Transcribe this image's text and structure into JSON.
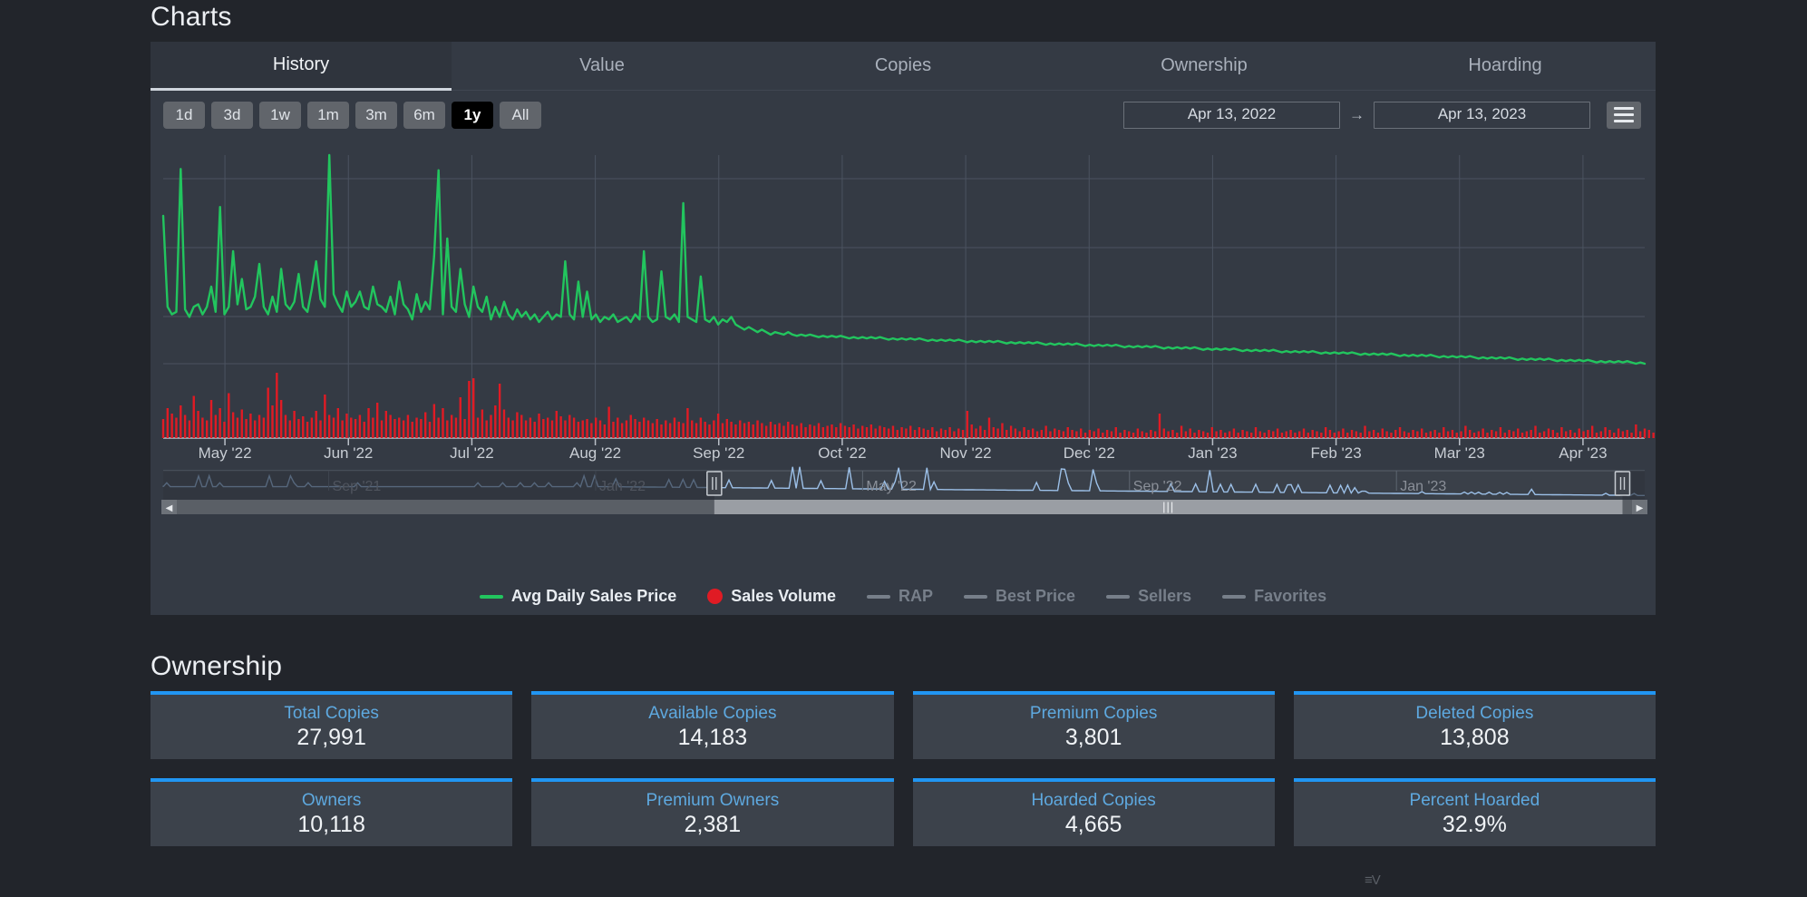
{
  "charts": {
    "title": "Charts",
    "tabs": [
      {
        "label": "History",
        "active": true
      },
      {
        "label": "Value",
        "active": false
      },
      {
        "label": "Copies",
        "active": false
      },
      {
        "label": "Ownership",
        "active": false
      },
      {
        "label": "Hoarding",
        "active": false
      }
    ],
    "range_buttons": [
      {
        "label": "1d",
        "active": false
      },
      {
        "label": "3d",
        "active": false
      },
      {
        "label": "1w",
        "active": false
      },
      {
        "label": "1m",
        "active": false
      },
      {
        "label": "3m",
        "active": false
      },
      {
        "label": "6m",
        "active": false
      },
      {
        "label": "1y",
        "active": true
      },
      {
        "label": "All",
        "active": false
      }
    ],
    "date_from": "Apr 13, 2022",
    "date_arrow": "→",
    "date_to": "Apr 13, 2023",
    "menu_icon": "hamburger-menu-icon",
    "legend": [
      {
        "label": "Avg Daily Sales Price",
        "marker": "line",
        "color": "#22c55e",
        "enabled": true
      },
      {
        "label": "Sales Volume",
        "marker": "dot",
        "color": "#e01b24",
        "enabled": true
      },
      {
        "label": "RAP",
        "marker": "line",
        "color": "#777f8a",
        "enabled": false
      },
      {
        "label": "Best Price",
        "marker": "line",
        "color": "#777f8a",
        "enabled": false
      },
      {
        "label": "Sellers",
        "marker": "line",
        "color": "#777f8a",
        "enabled": false
      },
      {
        "label": "Favorites",
        "marker": "line",
        "color": "#777f8a",
        "enabled": false
      }
    ]
  },
  "ownership": {
    "title": "Ownership",
    "cards": [
      {
        "label": "Total Copies",
        "value": "27,991"
      },
      {
        "label": "Available Copies",
        "value": "14,183"
      },
      {
        "label": "Premium Copies",
        "value": "3,801"
      },
      {
        "label": "Deleted Copies",
        "value": "13,808"
      },
      {
        "label": "Owners",
        "value": "10,118"
      },
      {
        "label": "Premium Owners",
        "value": "2,381"
      },
      {
        "label": "Hoarded Copies",
        "value": "4,665"
      },
      {
        "label": "Percent Hoarded",
        "value": "32.9%"
      }
    ]
  },
  "watermark": "≡V",
  "chart_data": {
    "type": "line",
    "title": "History",
    "xlabel": "",
    "ylabel": "",
    "grid": true,
    "legend_position": "bottom",
    "x_ticks": [
      "May '22",
      "Jun '22",
      "Jul '22",
      "Aug '22",
      "Sep '22",
      "Oct '22",
      "Nov '22",
      "Dec '22",
      "Jan '23",
      "Feb '23",
      "Mar '23",
      "Apr '23"
    ],
    "navigator": {
      "x_ticks": [
        "Sep '21",
        "Jan '22",
        "May '22",
        "Sep '22",
        "Jan '23"
      ],
      "selection_start_fraction": 0.372,
      "selection_end_fraction": 0.985,
      "color": "#9cc0e8"
    },
    "series": [
      {
        "name": "Avg Daily Sales Price",
        "type": "line",
        "color": "#22c55e",
        "values": [
          168,
          96,
          90,
          92,
          205,
          94,
          88,
          96,
          98,
          90,
          96,
          112,
          92,
          175,
          90,
          96,
          140,
          98,
          118,
          94,
          96,
          104,
          130,
          96,
          90,
          104,
          92,
          126,
          98,
          94,
          100,
          122,
          96,
          92,
          110,
          132,
          102,
          96,
          216,
          106,
          98,
          92,
          108,
          96,
          100,
          108,
          96,
          94,
          112,
          98,
          96,
          92,
          104,
          90,
          116,
          98,
          94,
          86,
          106,
          92,
          100,
          94,
          136,
          204,
          90,
          150,
          96,
          92,
          126,
          98,
          88,
          112,
          96,
          92,
          104,
          86,
          96,
          88,
          100,
          90,
          86,
          94,
          88,
          92,
          86,
          90,
          84,
          88,
          92,
          86,
          90,
          88,
          132,
          90,
          86,
          116,
          88,
          108,
          86,
          90,
          84,
          88,
          86,
          90,
          84,
          86,
          88,
          84,
          90,
          86,
          140,
          88,
          84,
          86,
          124,
          88,
          86,
          90,
          84,
          178,
          88,
          86,
          84,
          120,
          86,
          84,
          88,
          82,
          86,
          84,
          88,
          82,
          80,
          78,
          80,
          78,
          76,
          78,
          76,
          74,
          76,
          75,
          74,
          76,
          74,
          73,
          74,
          73,
          74,
          73,
          72,
          73,
          72,
          73,
          72,
          73,
          72,
          71,
          72,
          71,
          72,
          71,
          72,
          71,
          72,
          71,
          70,
          71,
          70,
          71,
          70,
          71,
          70,
          71,
          70,
          69,
          70,
          69,
          70,
          69,
          70,
          69,
          70,
          69,
          68,
          69,
          68,
          69,
          68,
          69,
          68,
          69,
          68,
          67,
          68,
          67,
          68,
          67,
          68,
          67,
          68,
          67,
          66,
          67,
          66,
          67,
          66,
          67,
          66,
          67,
          66,
          65,
          66,
          65,
          66,
          65,
          66,
          65,
          66,
          65,
          64,
          65,
          64,
          65,
          64,
          65,
          64,
          65,
          64,
          63,
          64,
          63,
          64,
          63,
          64,
          63,
          64,
          63,
          62,
          63,
          62,
          63,
          62,
          63,
          62,
          63,
          62,
          61,
          62,
          61,
          62,
          61,
          62,
          61,
          62,
          61,
          60,
          61,
          60,
          61,
          60,
          61,
          60,
          61,
          60,
          59,
          60,
          59,
          60,
          59,
          60,
          59,
          60,
          59,
          58,
          59,
          58,
          59,
          58,
          59,
          58,
          59,
          58,
          57,
          58,
          57,
          58,
          57,
          58,
          57,
          58,
          57,
          56,
          57,
          56,
          57,
          56,
          57,
          56,
          57,
          56,
          55,
          56,
          55,
          56,
          55,
          56,
          55,
          56,
          55,
          54,
          55,
          54,
          55,
          54,
          55,
          54,
          55,
          54,
          53,
          54,
          53,
          54,
          53,
          54,
          53,
          54,
          53,
          52,
          53,
          52,
          53,
          52,
          53,
          52,
          53,
          52,
          51,
          52,
          51
        ]
      },
      {
        "name": "Sales Volume",
        "type": "bar",
        "color": "#e01b24",
        "values": [
          28,
          44,
          36,
          30,
          48,
          34,
          26,
          62,
          40,
          30,
          26,
          56,
          34,
          44,
          24,
          66,
          38,
          30,
          42,
          28,
          36,
          26,
          34,
          30,
          74,
          48,
          96,
          56,
          34,
          26,
          40,
          28,
          32,
          24,
          30,
          40,
          26,
          64,
          34,
          30,
          44,
          26,
          36,
          30,
          28,
          34,
          24,
          44,
          30,
          52,
          26,
          40,
          34,
          28,
          30,
          26,
          34,
          24,
          30,
          28,
          38,
          24,
          50,
          30,
          44,
          26,
          34,
          30,
          60,
          28,
          84,
          88,
          30,
          42,
          26,
          34,
          48,
          80,
          42,
          30,
          26,
          38,
          34,
          26,
          30,
          24,
          36,
          28,
          30,
          26,
          40,
          32,
          26,
          34,
          30,
          24,
          26,
          28,
          22,
          30,
          26,
          20,
          46,
          24,
          30,
          22,
          26,
          34,
          28,
          24,
          30,
          26,
          22,
          28,
          20,
          26,
          22,
          30,
          24,
          22,
          44,
          26,
          22,
          30,
          24,
          20,
          26,
          36,
          22,
          28,
          24,
          20,
          26,
          22,
          24,
          20,
          26,
          22,
          18,
          24,
          20,
          22,
          18,
          24,
          20,
          18,
          22,
          16,
          20,
          18,
          22,
          16,
          18,
          20,
          16,
          22,
          18,
          16,
          20,
          14,
          18,
          16,
          20,
          14,
          18,
          16,
          14,
          18,
          12,
          16,
          14,
          18,
          12,
          16,
          14,
          12,
          16,
          10,
          14,
          12,
          16,
          10,
          14,
          12,
          40,
          20,
          14,
          18,
          12,
          30,
          16,
          14,
          22,
          12,
          18,
          14,
          10,
          16,
          12,
          14,
          10,
          12,
          18,
          10,
          14,
          12,
          10,
          16,
          12,
          10,
          14,
          8,
          12,
          10,
          14,
          8,
          12,
          10,
          16,
          8,
          12,
          10,
          8,
          14,
          10,
          8,
          12,
          10,
          36,
          14,
          10,
          12,
          8,
          18,
          10,
          14,
          8,
          12,
          10,
          8,
          16,
          10,
          12,
          8,
          10,
          14,
          8,
          12,
          10,
          8,
          16,
          10,
          8,
          12,
          10,
          14,
          8,
          10,
          12,
          8,
          10,
          14,
          8,
          12,
          10,
          8,
          16,
          12,
          8,
          10,
          14,
          8,
          12,
          10,
          8,
          18,
          10,
          12,
          8,
          14,
          10,
          8,
          12,
          16,
          10,
          8,
          12,
          10,
          14,
          8,
          10,
          12,
          8,
          16,
          10,
          12,
          8,
          10,
          18,
          12,
          8,
          10,
          14,
          8,
          12,
          10,
          16,
          8,
          12,
          10,
          14,
          8,
          10,
          12,
          18,
          8,
          10,
          14,
          12,
          8,
          16,
          10,
          12,
          8,
          14,
          10,
          12,
          18,
          8,
          10,
          16,
          12,
          8,
          14,
          10,
          12,
          8,
          20,
          10,
          14,
          12,
          8,
          16,
          10,
          12,
          22,
          8,
          14,
          10,
          12,
          16,
          8,
          10,
          34
        ]
      }
    ]
  }
}
